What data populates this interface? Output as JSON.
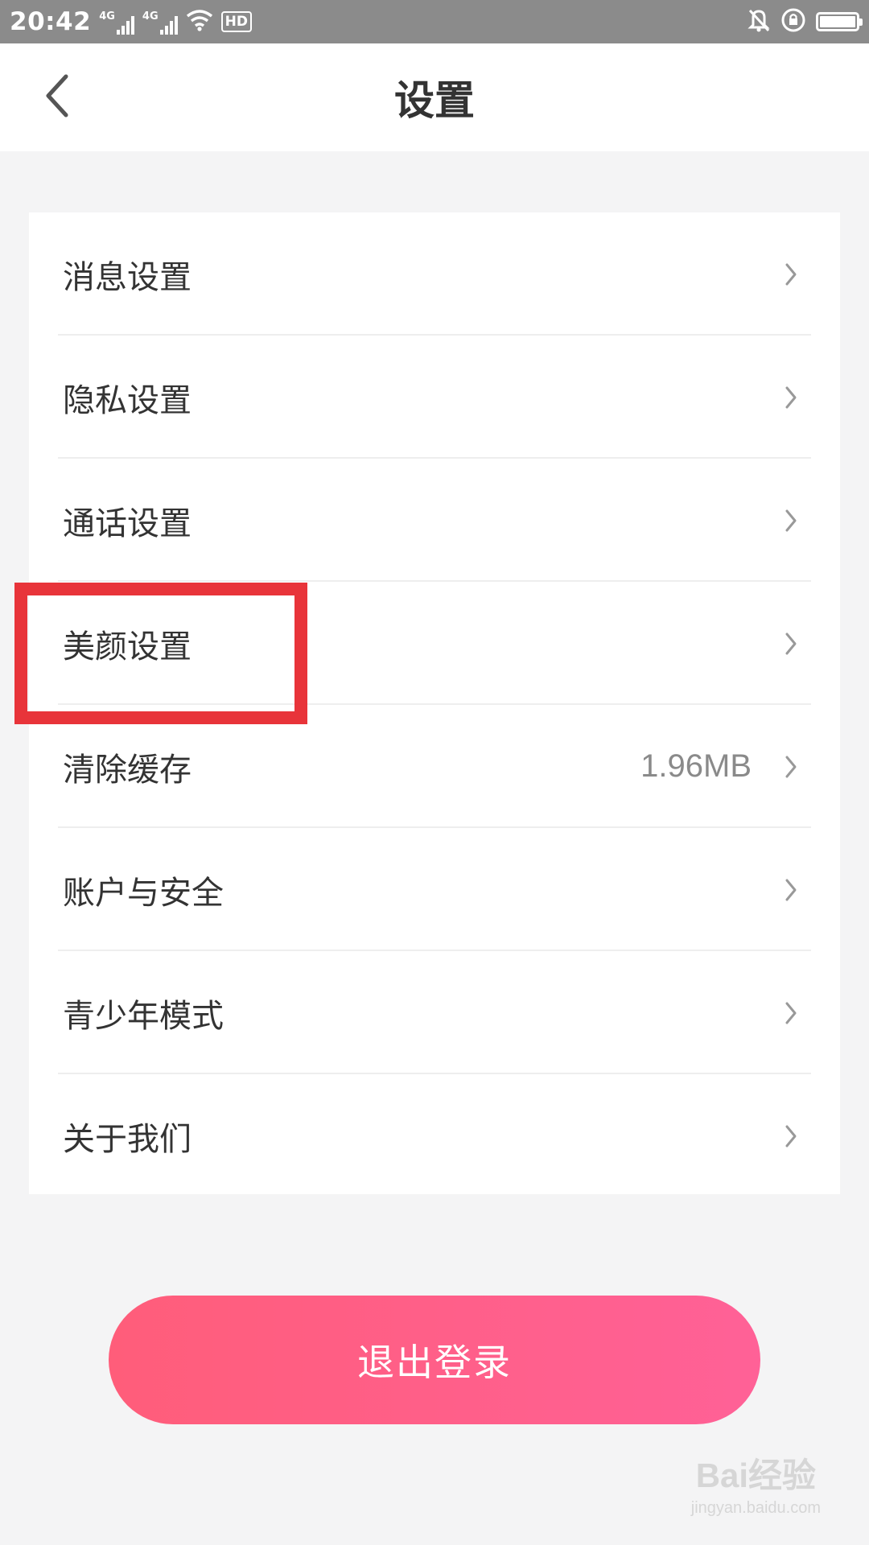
{
  "status_bar": {
    "time": "20:42",
    "network_1": "4G",
    "network_2": "4G",
    "hd_label": "HD",
    "icons": [
      "signal-icon",
      "wifi-icon",
      "hd-icon",
      "mute-bell-icon",
      "rotation-lock-icon",
      "battery-icon"
    ]
  },
  "header": {
    "title": "设置",
    "back_icon": "chevron-left-icon"
  },
  "settings": {
    "items": [
      {
        "label": "消息设置",
        "value": ""
      },
      {
        "label": "隐私设置",
        "value": ""
      },
      {
        "label": "通话设置",
        "value": ""
      },
      {
        "label": "美颜设置",
        "value": ""
      },
      {
        "label": "清除缓存",
        "value": "1.96MB"
      },
      {
        "label": "账户与安全",
        "value": ""
      },
      {
        "label": "青少年模式",
        "value": ""
      },
      {
        "label": "关于我们",
        "value": ""
      }
    ]
  },
  "logout": {
    "label": "退出登录"
  },
  "watermark": {
    "brand": "Bai经验",
    "url": "jingyan.baidu.com"
  },
  "colors": {
    "accent_start": "#ff5d7a",
    "accent_end": "#ff6197",
    "highlight": "#e8343a",
    "background": "#f4f4f5"
  }
}
